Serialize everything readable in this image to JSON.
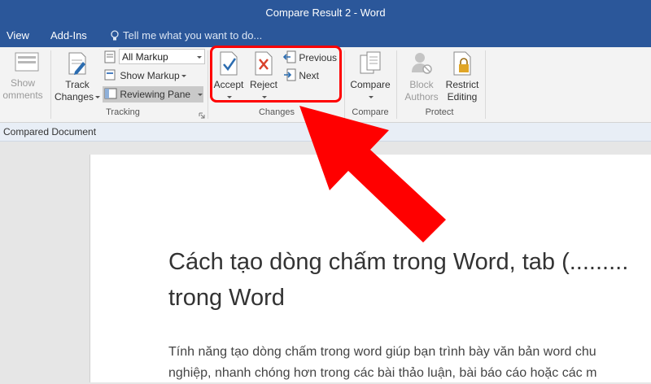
{
  "window": {
    "title": "Compare Result 2 - Word"
  },
  "tabs": {
    "view": "View",
    "addins": "Add-Ins",
    "tell_me": "Tell me what you want to do..."
  },
  "ribbon": {
    "show_comments": {
      "line1": "Show",
      "line2": "omments"
    },
    "tracking": {
      "track_changes": {
        "line1": "Track",
        "line2": "Changes"
      },
      "markup_combo": "All Markup",
      "show_markup": "Show Markup",
      "reviewing_pane": "Reviewing Pane",
      "label": "Tracking"
    },
    "changes": {
      "accept": "Accept",
      "reject": "Reject",
      "previous": "Previous",
      "next": "Next",
      "label": "Changes"
    },
    "compare": {
      "button": "Compare",
      "label": "Compare"
    },
    "protect": {
      "block_authors": {
        "line1": "Block",
        "line2": "Authors"
      },
      "restrict_editing": {
        "line1": "Restrict",
        "line2": "Editing"
      },
      "label": "Protect"
    }
  },
  "subbar": {
    "label": "Compared Document"
  },
  "document": {
    "heading_line1": "Cách tạo dòng chấm trong Word, tab (.........",
    "heading_line2": "trong Word",
    "para_line1": "Tính năng tạo dòng chấm trong word giúp bạn trình bày văn bản word chu",
    "para_line2": "nghiệp, nhanh chóng hơn trong các bài thảo luận, bài báo cáo hoặc các m"
  },
  "annotation_color": "#ff0000"
}
